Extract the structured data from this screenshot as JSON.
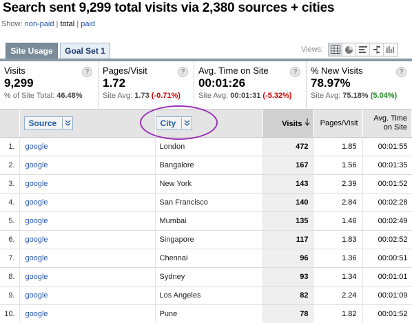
{
  "page": {
    "title": "Search sent 9,299 total visits via 2,380 sources + cities",
    "show_label": "Show:",
    "filter_nonpaid": "non-paid",
    "filter_total": "total",
    "filter_paid": "paid",
    "filter_sep": "|"
  },
  "tabs": [
    {
      "label": "Site Usage",
      "active": true
    },
    {
      "label": "Goal Set 1",
      "active": false
    }
  ],
  "views": {
    "label": "Views:",
    "icons": [
      "table-view-icon",
      "pie-view-icon",
      "performance-view-icon",
      "comparison-view-icon",
      "pivot-view-icon"
    ]
  },
  "summary": {
    "visits": {
      "label": "Visits",
      "value": "9,299",
      "sub_prefix": "% of Site Total:",
      "sub_value": "46.48%"
    },
    "pages_per_visit": {
      "label": "Pages/Visit",
      "value": "1.72",
      "sub_prefix": "Site Avg:",
      "sub_value": "1.73",
      "change": "(-0.71%)"
    },
    "avg_time": {
      "label": "Avg. Time on Site",
      "value": "00:01:26",
      "sub_prefix": "Site Avg:",
      "sub_value": "00:01:31",
      "change": "(-5.32%)"
    },
    "new_visits": {
      "label": "% New Visits",
      "value": "78.97%",
      "sub_prefix": "Site Avg:",
      "sub_value": "75.18%",
      "change": "(5.04%)"
    },
    "help": "?"
  },
  "table": {
    "columns": {
      "source": "Source",
      "city": "City",
      "visits": "Visits",
      "pages_per_visit": "Pages/Visit",
      "avg_time": "Avg. Time on Site"
    },
    "rows": [
      {
        "n": "1.",
        "source": "google",
        "city": "London",
        "visits": "472",
        "ppv": "1.85",
        "time": "00:01:55"
      },
      {
        "n": "2.",
        "source": "google",
        "city": "Bangalore",
        "visits": "167",
        "ppv": "1.56",
        "time": "00:01:35"
      },
      {
        "n": "3.",
        "source": "google",
        "city": "New York",
        "visits": "143",
        "ppv": "2.39",
        "time": "00:01:52"
      },
      {
        "n": "4.",
        "source": "google",
        "city": "San Francisco",
        "visits": "140",
        "ppv": "2.84",
        "time": "00:02:28"
      },
      {
        "n": "5.",
        "source": "google",
        "city": "Mumbai",
        "visits": "135",
        "ppv": "1.46",
        "time": "00:02:49"
      },
      {
        "n": "6.",
        "source": "google",
        "city": "Singapore",
        "visits": "117",
        "ppv": "1.83",
        "time": "00:02:52"
      },
      {
        "n": "7.",
        "source": "google",
        "city": "Chennai",
        "visits": "96",
        "ppv": "1.36",
        "time": "00:00:51"
      },
      {
        "n": "8.",
        "source": "google",
        "city": "Sydney",
        "visits": "93",
        "ppv": "1.34",
        "time": "00:01:01"
      },
      {
        "n": "9.",
        "source": "google",
        "city": "Los Angeles",
        "visits": "82",
        "ppv": "2.24",
        "time": "00:01:09"
      },
      {
        "n": "10.",
        "source": "google",
        "city": "Pune",
        "visits": "78",
        "ppv": "1.82",
        "time": "00:01:52"
      }
    ]
  },
  "colors": {
    "link": "#2255aa",
    "negative": "#cc0000",
    "positive": "#228822",
    "highlight_circle": "#9b30b8",
    "active_tab": "#7a8c99"
  }
}
